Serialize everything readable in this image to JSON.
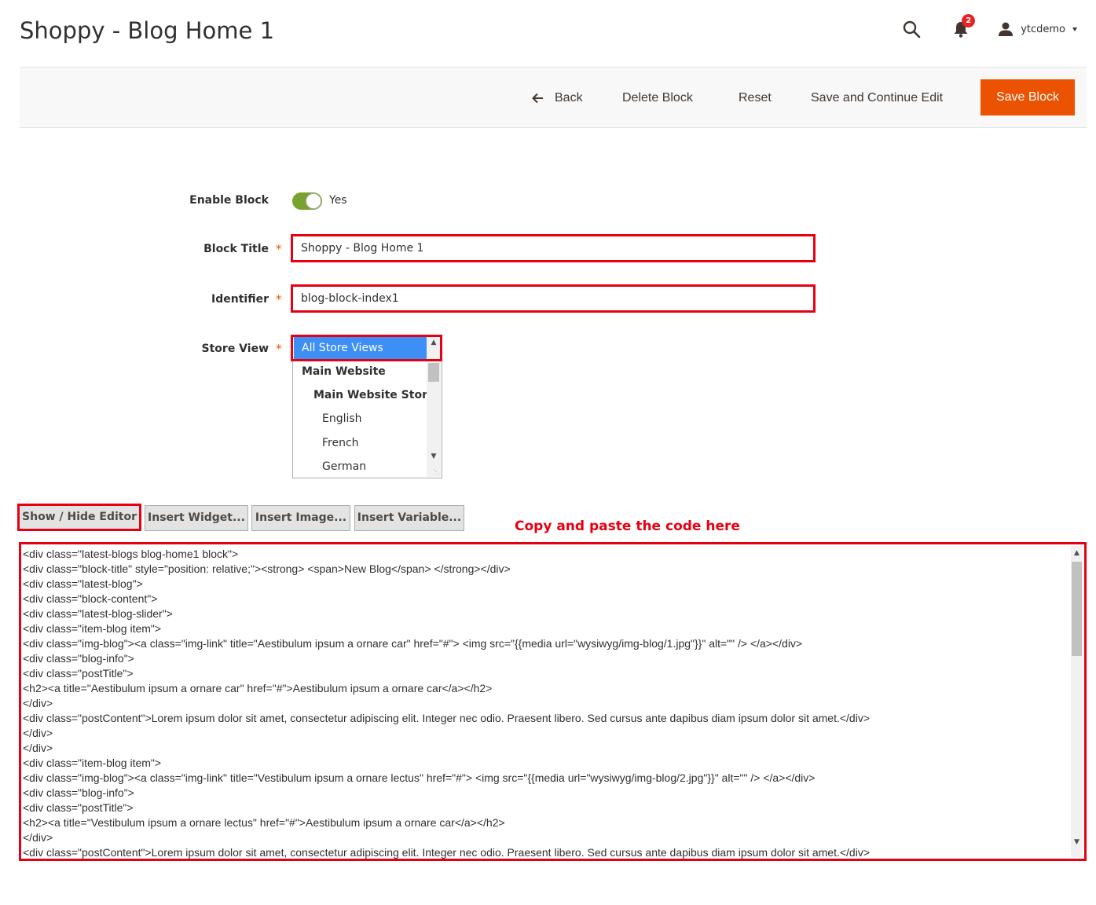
{
  "page": {
    "title": "Shoppy - Blog Home 1"
  },
  "header": {
    "notifications_count": "2",
    "username": "ytcdemo"
  },
  "toolbar": {
    "back_label": "Back",
    "delete_label": "Delete Block",
    "reset_label": "Reset",
    "save_continue_label": "Save and Continue Edit",
    "save_label": "Save Block"
  },
  "form": {
    "enable_block": {
      "label": "Enable Block",
      "value": "Yes",
      "enabled": true
    },
    "block_title": {
      "label": "Block Title",
      "required_mark": "*",
      "value": "Shoppy - Blog Home 1"
    },
    "identifier": {
      "label": "Identifier",
      "required_mark": "*",
      "value": "blog-block-index1"
    },
    "store_view": {
      "label": "Store View",
      "required_mark": "*",
      "options": [
        {
          "label": "All Store Views",
          "selected": true,
          "bold": false
        },
        {
          "label": "Main Website",
          "selected": false,
          "bold": true
        },
        {
          "label": "Main Website Store",
          "selected": false,
          "bold": true
        },
        {
          "label": "English",
          "selected": false,
          "bold": false
        },
        {
          "label": "French",
          "selected": false,
          "bold": false
        },
        {
          "label": "German",
          "selected": false,
          "bold": false
        }
      ]
    }
  },
  "editor": {
    "show_hide_label": "Show / Hide Editor",
    "insert_widget_label": "Insert Widget...",
    "insert_image_label": "Insert Image...",
    "insert_variable_label": "Insert Variable...",
    "annotation": "Copy and paste the code here",
    "code_lines": [
      "<div class=\"latest-blogs blog-home1 block\">",
      "<div class=\"block-title\" style=\"position: relative;\"><strong> <span>New Blog</span> </strong></div>",
      "<div class=\"latest-blog\">",
      "<div class=\"block-content\">",
      "<div class=\"latest-blog-slider\">",
      "<div class=\"item-blog item\">",
      "<div class=\"img-blog\"><a class=\"img-link\" title=\"Aestibulum ipsum a ornare car\" href=\"#\"> <img src=\"{{media url=\"wysiwyg/img-blog/1.jpg\"}}\" alt=\"\" /> </a></div>",
      "<div class=\"blog-info\">",
      "<div class=\"postTitle\">",
      "<h2><a title=\"Aestibulum ipsum a ornare car\" href=\"#\">Aestibulum ipsum a ornare car</a></h2>",
      "</div>",
      "<div class=\"postContent\">Lorem ipsum dolor sit amet, consectetur adipiscing elit. Integer nec odio. Praesent libero. Sed cursus ante dapibus diam ipsum dolor sit amet.</div>",
      "</div>",
      "</div>",
      "<div class=\"item-blog item\">",
      "<div class=\"img-blog\"><a class=\"img-link\" title=\"Vestibulum ipsum a ornare lectus\" href=\"#\"> <img src=\"{{media url=\"wysiwyg/img-blog/2.jpg\"}}\" alt=\"\" /> </a></div>",
      "<div class=\"blog-info\">",
      "<div class=\"postTitle\">",
      "<h2><a title=\"Vestibulum ipsum a ornare lectus\" href=\"#\">Aestibulum ipsum a ornare car</a></h2>",
      "</div>",
      "<div class=\"postContent\">Lorem ipsum dolor sit amet, consectetur adipiscing elit. Integer nec odio. Praesent libero. Sed cursus ante dapibus diam ipsum dolor sit amet.</div>"
    ]
  },
  "colors": {
    "primary_button": "#eb5202",
    "toggle_on": "#79a22e",
    "selected_option": "#3d8ff5",
    "annotation_red": "#e60012",
    "notification_badge": "#e22626"
  },
  "icons": {
    "search": "search-icon",
    "notifications": "bell-icon",
    "user": "user-icon",
    "back": "arrow-left-icon"
  }
}
